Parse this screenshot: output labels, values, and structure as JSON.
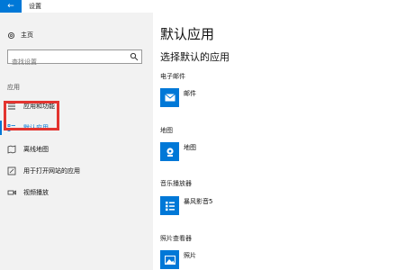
{
  "window": {
    "title": "设置"
  },
  "sidebar": {
    "home_label": "主页",
    "search_placeholder": "查找设置",
    "section_label": "应用",
    "items": [
      {
        "label": "应用和功能",
        "icon": "list-icon"
      },
      {
        "label": "默认应用",
        "icon": "default-apps-icon",
        "selected": true
      },
      {
        "label": "离线地图",
        "icon": "map-icon"
      },
      {
        "label": "用于打开网站的应用",
        "icon": "open-in-app-icon"
      },
      {
        "label": "视频播放",
        "icon": "video-icon"
      }
    ]
  },
  "main": {
    "title": "默认应用",
    "subtitle": "选择默认的应用",
    "categories": [
      {
        "label": "电子邮件",
        "app": "邮件",
        "icon": "mail-icon"
      },
      {
        "label": "地图",
        "app": "地图",
        "icon": "maps-icon"
      },
      {
        "label": "音乐播放器",
        "app": "暴风影音5",
        "icon": "media-player-icon"
      },
      {
        "label": "照片查看器",
        "app": "照片",
        "icon": "photos-icon"
      }
    ]
  },
  "colors": {
    "accent": "#0078d7",
    "highlight": "#e3342f",
    "sidebar_bg": "#f2f2f2"
  }
}
